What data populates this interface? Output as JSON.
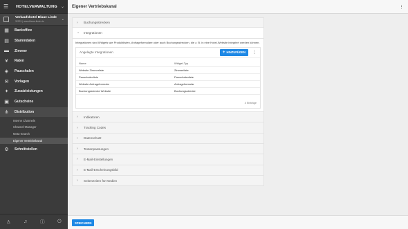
{
  "app": {
    "title": "HOTELVERWALTUNG"
  },
  "hotel": {
    "name": "Verkaufshotel Blaue Linde",
    "subtitle": "32221 | www.blaue-linde.de"
  },
  "sidebar": {
    "items": [
      {
        "label": "Backoffice",
        "icon": "backoffice-icon"
      },
      {
        "label": "Stammdaten",
        "icon": "master-data-icon"
      },
      {
        "label": "Zimmer",
        "icon": "bed-icon"
      },
      {
        "label": "Raten",
        "icon": "rates-icon"
      },
      {
        "label": "Pauschalen",
        "icon": "package-icon"
      },
      {
        "label": "Vorlagen",
        "icon": "templates-icon"
      },
      {
        "label": "Zusatzleistungen",
        "icon": "extras-icon"
      },
      {
        "label": "Gutscheine",
        "icon": "voucher-icon"
      },
      {
        "label": "Distribution",
        "icon": "distribution-icon"
      }
    ],
    "subitems": [
      {
        "label": "Interne Channels"
      },
      {
        "label": "Channel-Manager"
      },
      {
        "label": "Meta-Search"
      },
      {
        "label": "Eigener Vertriebskanal"
      }
    ],
    "after": {
      "label": "Schnittstellen",
      "icon": "interfaces-icon"
    }
  },
  "header": {
    "title": "Eigener Vertriebskanal"
  },
  "sections": {
    "top": [
      {
        "label": "Buchungsstrecken"
      }
    ],
    "open": {
      "label": "Integrationen",
      "description": "Integrationen sind Widgets wie Produktlisten, Anfrageformulare oder auch Buchungsstrecken, die z. B. in eine Hotel-Website integriert werden können.",
      "card_title": "Angelegte Integrationen",
      "add_label": "HINZUFÜGEN",
      "columns": [
        "Name",
        "Widget-Typ"
      ],
      "rows": [
        [
          "Website Zimmerliste",
          "Zimmerliste"
        ],
        [
          "Pauschalenliste",
          "Pauschalenliste"
        ],
        [
          "Website Anfrageformular",
          "Anfrageformular"
        ],
        [
          "Buchungsstrecke Website",
          "Buchungsstrecke"
        ]
      ],
      "count": "4 Einträge"
    },
    "bottom": [
      {
        "label": "Indikatoren"
      },
      {
        "label": "Tracking Codes"
      },
      {
        "label": "Datenschutz"
      },
      {
        "label": "Textanpassungen"
      },
      {
        "label": "E-Mail-Einstellungen"
      },
      {
        "label": "E-Mail-Erscheinungsbild"
      },
      {
        "label": "Seitenzeiten für Medien"
      }
    ]
  },
  "footer": {
    "save_label": "SPEICHERN"
  },
  "colors": {
    "accent": "#1e88e5",
    "sidebar": "#3b3b3b"
  }
}
